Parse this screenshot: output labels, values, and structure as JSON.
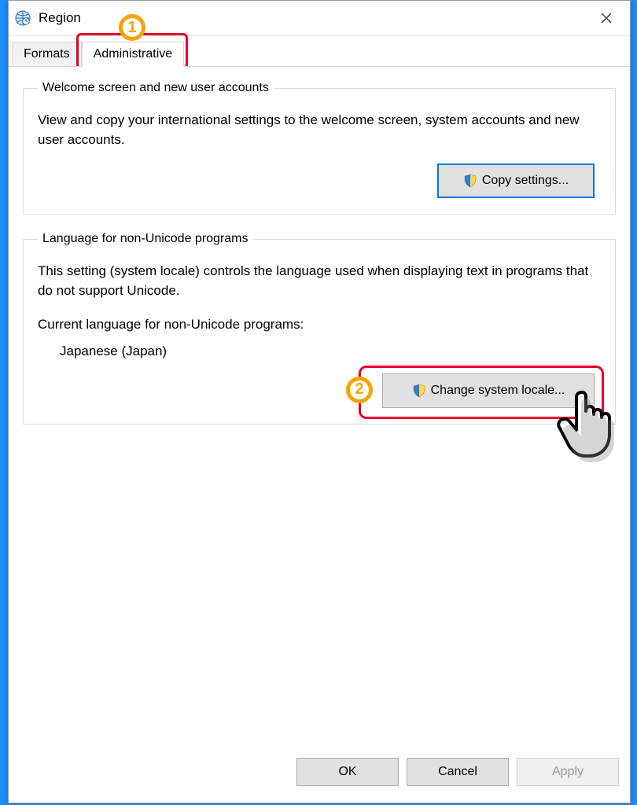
{
  "window": {
    "title": "Region"
  },
  "tabs": {
    "formats": "Formats",
    "administrative": "Administrative"
  },
  "group1": {
    "legend": "Welcome screen and new user accounts",
    "desc": "View and copy your international settings to the welcome screen, system accounts and new user accounts.",
    "button": "Copy settings..."
  },
  "group2": {
    "legend": "Language for non-Unicode programs",
    "desc": "This setting (system locale) controls the language used when displaying text in programs that do not support Unicode.",
    "current_label": "Current language for non-Unicode programs:",
    "current_value": "Japanese (Japan)",
    "button": "Change system locale..."
  },
  "footer": {
    "ok": "OK",
    "cancel": "Cancel",
    "apply": "Apply"
  },
  "annotations": {
    "step1": "1",
    "step2": "2"
  }
}
